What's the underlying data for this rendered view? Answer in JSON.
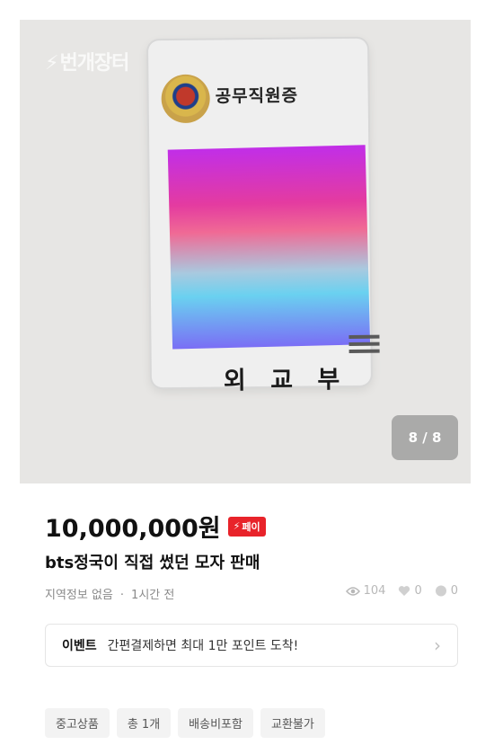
{
  "image": {
    "watermark": "번개장터",
    "card_title": "공무직원증",
    "ministry": "외 교 부",
    "page_indicator": "8 / 8"
  },
  "product": {
    "price": "10,000,000원",
    "pay_badge": "페이",
    "title": "bts정국이 직접 썼던 모자 판매",
    "location": "지역정보 없음",
    "time": "1시간 전",
    "views": "104",
    "likes": "0",
    "chats": "0"
  },
  "event": {
    "tag": "이벤트",
    "text": "간편결제하면 최대 1만 포인트 도착!"
  },
  "tags": [
    "중고상품",
    "총 1개",
    "배송비포함",
    "교환불가"
  ],
  "colors": {
    "pay_badge": "#e8232a",
    "photo_bg": "#e7e6e4"
  }
}
